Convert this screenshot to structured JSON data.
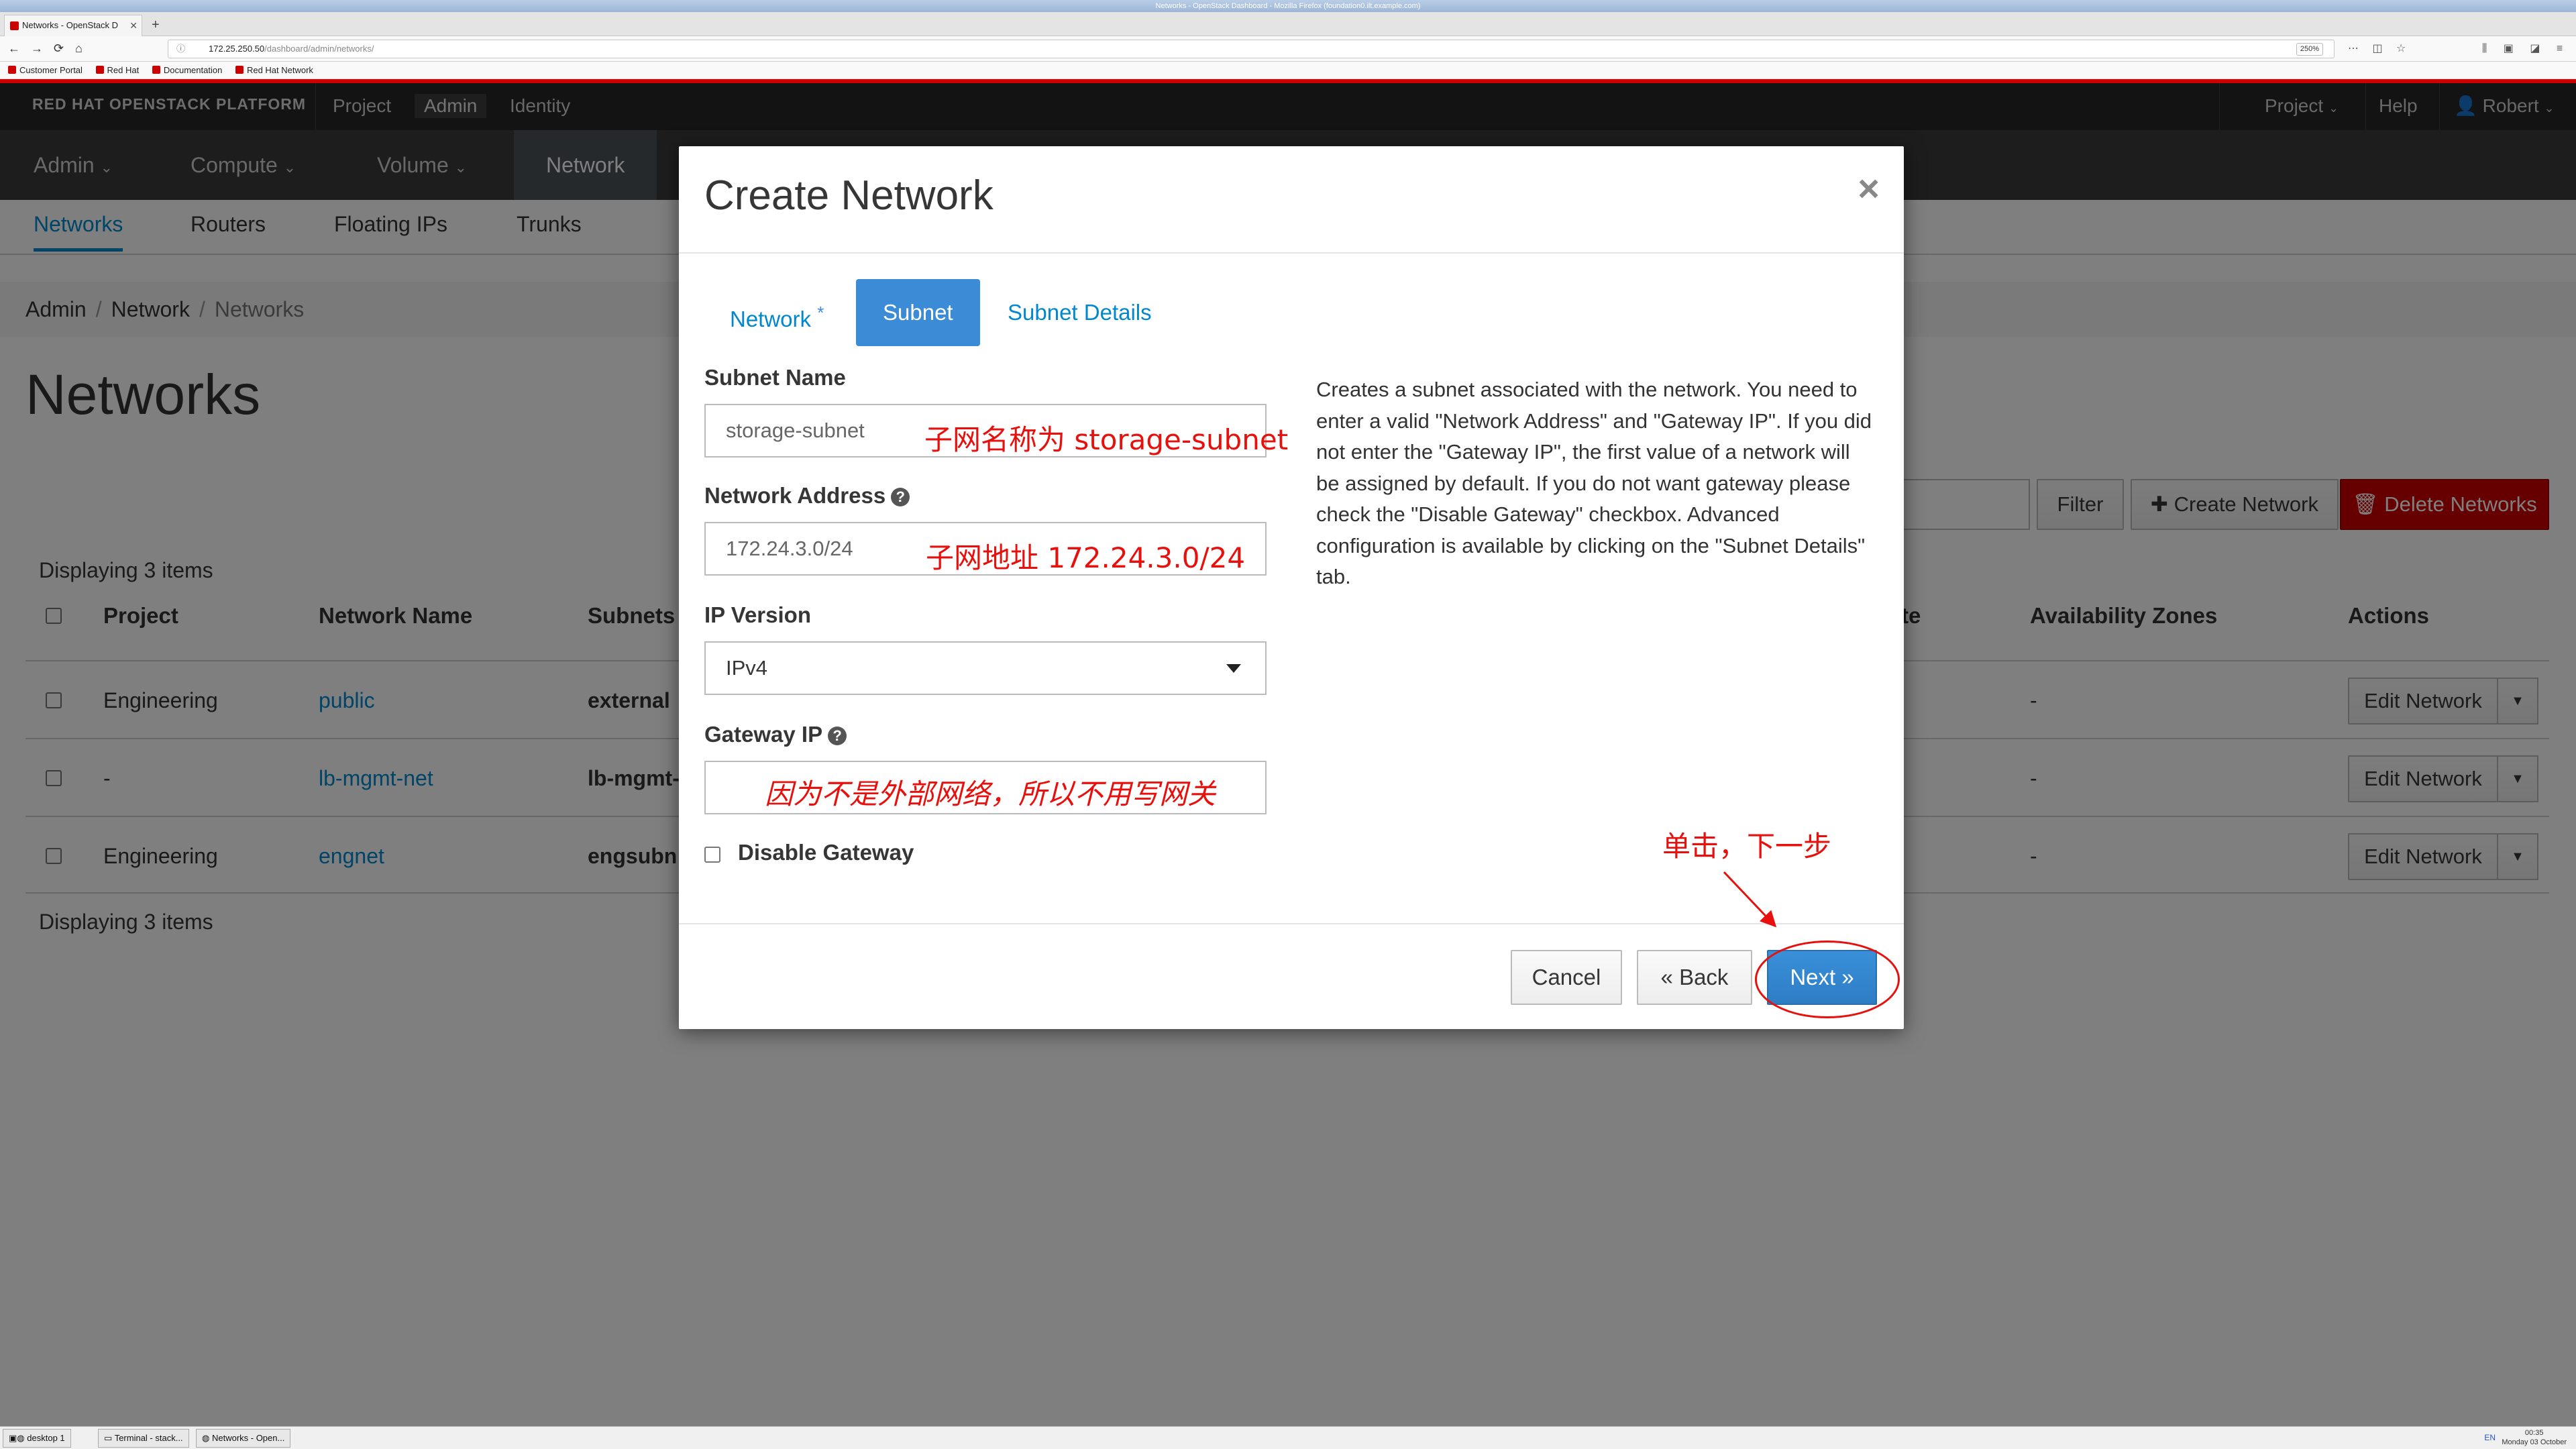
{
  "browser": {
    "window_title": "Networks - OpenStack Dashboard - Mozilla Firefox (foundation0.ilt.example.com)",
    "tab_title": "Networks - OpenStack D",
    "url_host": "172.25.250.50",
    "url_path": "/dashboard/admin/networks/",
    "zoom": "250%",
    "bookmarks": [
      "Customer Portal",
      "Red Hat",
      "Documentation",
      "Red Hat Network"
    ]
  },
  "topnav": {
    "brand": "RED HAT OPENSTACK PLATFORM",
    "items": [
      "Project",
      "Admin",
      "Identity"
    ],
    "right": {
      "project": "Project",
      "help": "Help",
      "user": "Robert"
    }
  },
  "secnav": {
    "items": [
      "Admin",
      "Compute",
      "Volume",
      "Network"
    ]
  },
  "tertnav": {
    "items": [
      "Networks",
      "Routers",
      "Floating IPs",
      "Trunks"
    ]
  },
  "breadcrumb": [
    "Admin",
    "Network",
    "Networks"
  ],
  "page_title": "Networks",
  "toolbar": {
    "filter": "Filter",
    "create": "Create Network",
    "delete": "Delete Networks"
  },
  "table": {
    "displaying": "Displaying 3 items",
    "headers": [
      "Project",
      "Network Name",
      "Subnets",
      "te",
      "Availability Zones",
      "Actions"
    ],
    "rows": [
      {
        "project": "Engineering",
        "name": "public",
        "subnets": "external",
        "az": "-",
        "action": "Edit Network"
      },
      {
        "project": "-",
        "name": "lb-mgmt-net",
        "subnets": "lb-mgmt-",
        "az": "-",
        "action": "Edit Network"
      },
      {
        "project": "Engineering",
        "name": "engnet",
        "subnets": "engsubn",
        "az": "-",
        "action": "Edit Network"
      }
    ]
  },
  "modal": {
    "title": "Create Network",
    "close": "×",
    "tabs": [
      {
        "label": "Network",
        "required": "*"
      },
      {
        "label": "Subnet"
      },
      {
        "label": "Subnet Details"
      }
    ],
    "subnet_name": {
      "label": "Subnet Name",
      "value": "storage-subnet"
    },
    "network_address": {
      "label": "Network Address",
      "value": "172.24.3.0/24"
    },
    "ip_version": {
      "label": "IP Version",
      "value": "IPv4"
    },
    "gateway_ip": {
      "label": "Gateway IP",
      "value": ""
    },
    "disable_gateway": {
      "label": "Disable Gateway",
      "checked": false
    },
    "description": "Creates a subnet associated with the network. You need to enter a valid \"Network Address\" and \"Gateway IP\". If you did not enter the \"Gateway IP\", the first value of a network will be assigned by default. If you do not want gateway please check the \"Disable Gateway\" checkbox. Advanced configuration is available by clicking on the \"Subnet Details\" tab.",
    "buttons": {
      "cancel": "Cancel",
      "back": "« Back",
      "next": "Next »"
    }
  },
  "annotations": {
    "subnet_name": "子网名称为 storage-subnet",
    "network_address": "子网地址 172.24.3.0/24",
    "gateway": "因为不是外部网络，所以不用写网关",
    "click_next": "单击，下一步",
    "color": "#e8100c"
  },
  "taskbar": {
    "items": [
      "desktop 1",
      "Terminal - stack...",
      "Networks - Open..."
    ],
    "lang": "EN",
    "time": "00:35",
    "date": "Monday 03 October"
  }
}
